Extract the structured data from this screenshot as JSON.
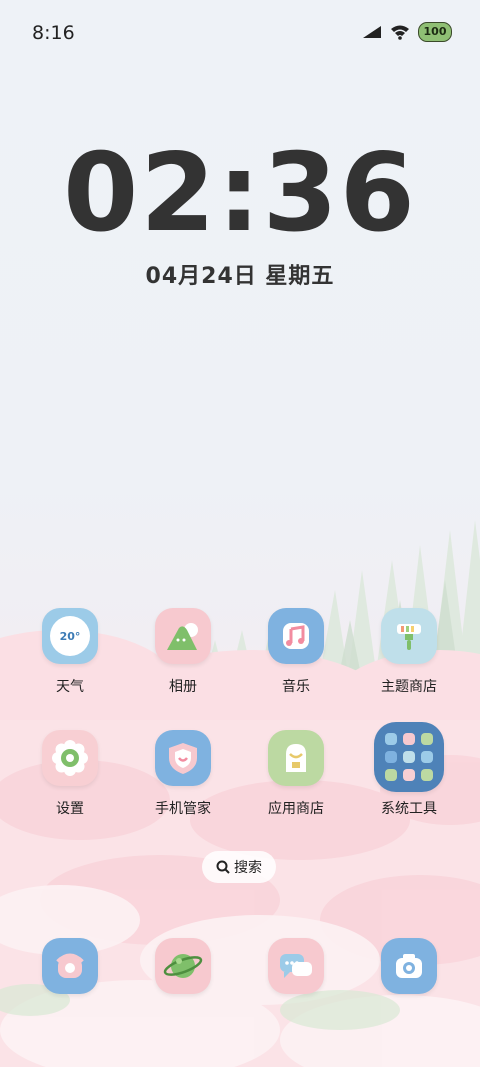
{
  "status_bar": {
    "time": "8:16",
    "battery_level": "100",
    "icons": [
      "signal-icon",
      "wifi-icon",
      "battery-icon"
    ]
  },
  "clock": {
    "time": "02:36",
    "date": "04月24日 星期五"
  },
  "apps": [
    {
      "label": "天气",
      "icon": "weather-icon",
      "bg": "#9ccbe8",
      "temp": "20°"
    },
    {
      "label": "相册",
      "icon": "gallery-icon",
      "bg": "#f7c9cf"
    },
    {
      "label": "音乐",
      "icon": "music-icon",
      "bg": "#7fb2e0"
    },
    {
      "label": "主题商店",
      "icon": "theme-store-icon",
      "bg": "#bfdfea"
    },
    {
      "label": "设置",
      "icon": "settings-icon",
      "bg": "#f8cfd3"
    },
    {
      "label": "手机管家",
      "icon": "phone-manager-icon",
      "bg": "#7fb2e0"
    },
    {
      "label": "应用商店",
      "icon": "app-store-icon",
      "bg": "#bcd9a2"
    },
    {
      "label": "系统工具",
      "icon": "system-tools-folder-icon",
      "bg": "#4e82b8"
    }
  ],
  "search": {
    "label": "搜索"
  },
  "dock": [
    {
      "icon": "phone-icon",
      "bg": "#7fb2e0"
    },
    {
      "icon": "browser-icon",
      "bg": "#f7c9cf"
    },
    {
      "icon": "messages-icon",
      "bg": "#f7c9cf"
    },
    {
      "icon": "camera-icon",
      "bg": "#7fb2e0"
    }
  ]
}
